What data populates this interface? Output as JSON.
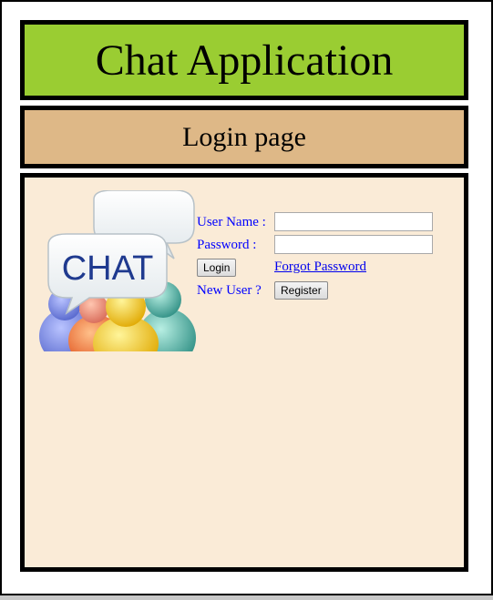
{
  "header": {
    "title": "Chat Application"
  },
  "subheader": {
    "title": "Login page"
  },
  "logo": {
    "text": "CHAT"
  },
  "form": {
    "username_label": "User Name :",
    "username_value": "",
    "password_label": "Password :",
    "password_value": "",
    "login_label": "Login",
    "forgot_password_label": "Forgot Password",
    "new_user_label": "New User ?",
    "register_label": "Register"
  },
  "colors": {
    "header_bg": "#9acd32",
    "subheader_bg": "#deb887",
    "content_bg": "#faebd7",
    "label_color": "#0000ff"
  }
}
